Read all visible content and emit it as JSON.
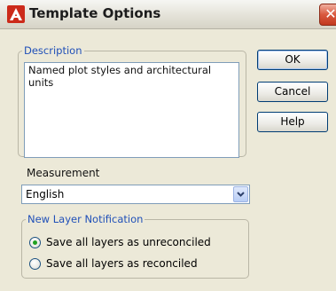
{
  "window": {
    "title": "Template Options",
    "close_glyph": "✕",
    "icon": "autocad-icon",
    "accent_color": "#cc2a1a"
  },
  "description_group": {
    "legend": "Description",
    "text": "Named plot styles and architectural units"
  },
  "buttons": {
    "ok": "OK",
    "cancel": "Cancel",
    "help": "Help"
  },
  "measurement": {
    "label": "Measurement",
    "selected": "English"
  },
  "layer_notification": {
    "legend": "New Layer Notification",
    "options": [
      {
        "label": "Save all layers as unreconciled",
        "checked": true
      },
      {
        "label": "Save all layers as reconciled",
        "checked": false
      }
    ]
  }
}
